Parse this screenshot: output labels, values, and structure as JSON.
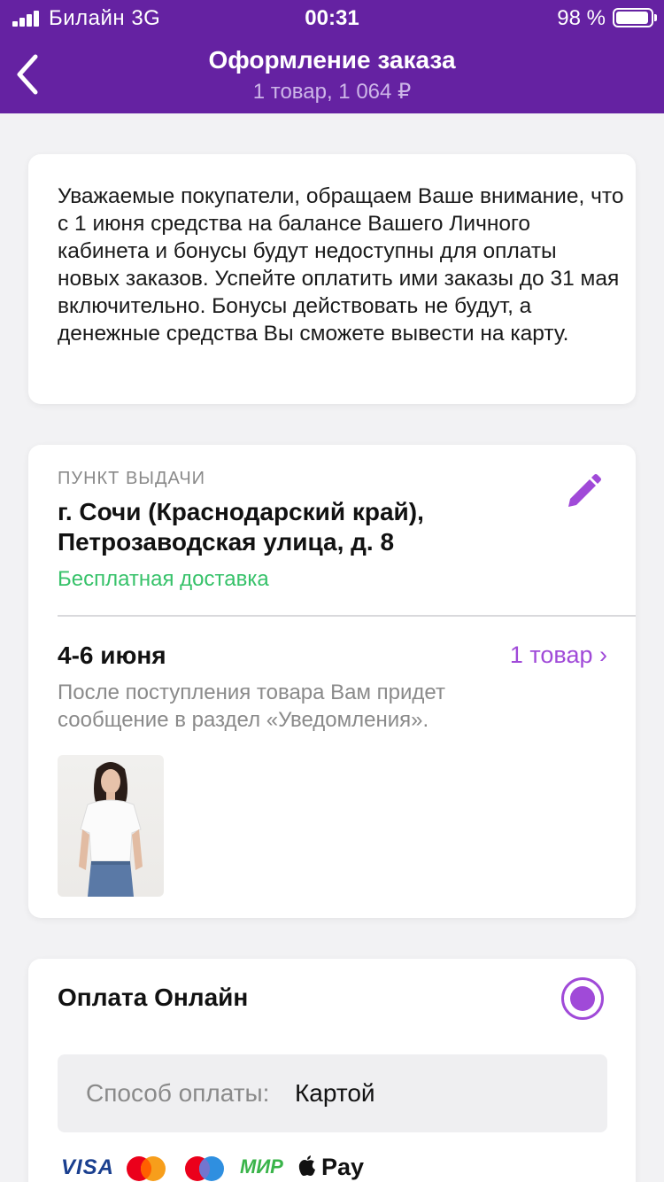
{
  "status_bar": {
    "carrier": "Билайн  3G",
    "time": "00:31",
    "battery": "98 %"
  },
  "nav": {
    "title": "Оформление заказа",
    "subtitle": "1 товар, 1 064 ₽"
  },
  "notice": {
    "text": "Уважаемые покупатели, обращаем Ваше внимание, что с 1 июня средства на балансе Вашего Личного кабинета и бонусы будут недоступны для оплаты новых заказов.  Успейте оплатить ими заказы до 31 мая включительно. Бонусы действовать не будут, а денежные средства Вы сможете вывести на карту."
  },
  "pickup": {
    "label": "ПУНКТ ВЫДАЧИ",
    "address": "г. Сочи (Краснодарский край), Петрозаводская улица, д. 8",
    "delivery_note": "Бесплатная доставка",
    "date": "4-6 июня",
    "items_link": "1 товар ›",
    "hint": "После поступления товара Вам придет сообщение в раздел «Уведомления»."
  },
  "payment": {
    "title": "Оплата Онлайн",
    "method_label": "Способ оплаты:",
    "method_value": "Картой",
    "logos": {
      "visa": "VISA",
      "mir": "МИР",
      "apple_pay": "Pay"
    }
  },
  "colors": {
    "header": "#6522a2",
    "accent": "#a04ad8",
    "success": "#37c26a"
  }
}
